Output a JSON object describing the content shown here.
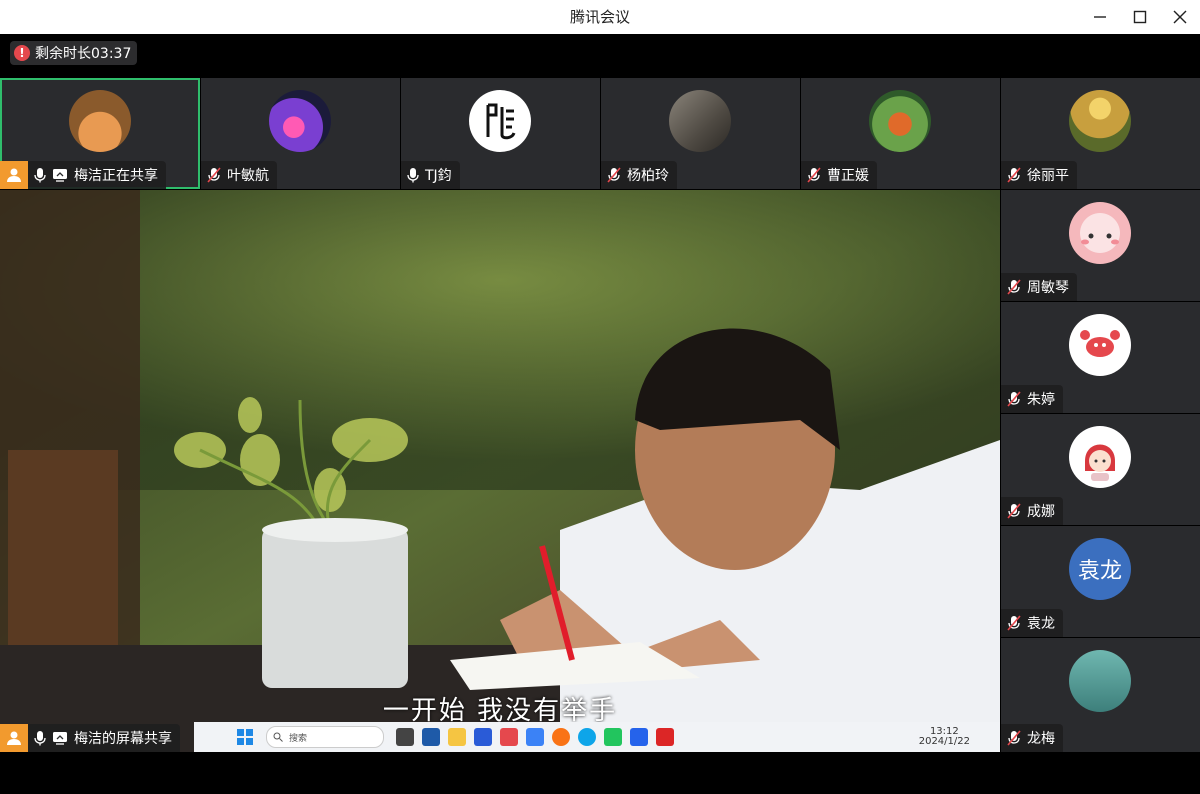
{
  "window": {
    "title": "腾讯会议"
  },
  "timer": {
    "label": "剩余时长03:37"
  },
  "top_row": [
    {
      "name": "梅洁正在共享",
      "mic": "on",
      "sharing": true,
      "host": true,
      "avatar_color": "#d0833f"
    },
    {
      "name": "叶敏航",
      "mic": "muted",
      "avatar_color": "#6c3fa8"
    },
    {
      "name": "TJ鈞",
      "mic": "on",
      "avatar_color": "#ffffff"
    },
    {
      "name": "杨柏玲",
      "mic": "muted",
      "avatar_color": "#6d675e"
    },
    {
      "name": "曹正媛",
      "mic": "muted",
      "avatar_color": "#4f7d3a"
    },
    {
      "name": "徐丽平",
      "mic": "muted",
      "avatar_color": "#c89f3e"
    }
  ],
  "right_column": [
    {
      "name": "周敏琴",
      "mic": "muted",
      "avatar_color": "#f7c9cc"
    },
    {
      "name": "朱婷",
      "mic": "muted",
      "avatar_color": "#ffffff"
    },
    {
      "name": "成娜",
      "mic": "muted",
      "avatar_color": "#f2d6da"
    },
    {
      "name": "袁龙",
      "mic": "muted",
      "avatar_text": "袁龙",
      "avatar_color": "#3b6fbf"
    },
    {
      "name": "龙梅",
      "mic": "muted",
      "avatar_color": "#4a8f8c"
    }
  ],
  "share": {
    "label": "梅洁的屏幕共享",
    "subtitle": "一开始 我没有举手",
    "taskbar": {
      "search_placeholder": "搜索",
      "time": "13:12",
      "date": "2024/1/22"
    }
  }
}
